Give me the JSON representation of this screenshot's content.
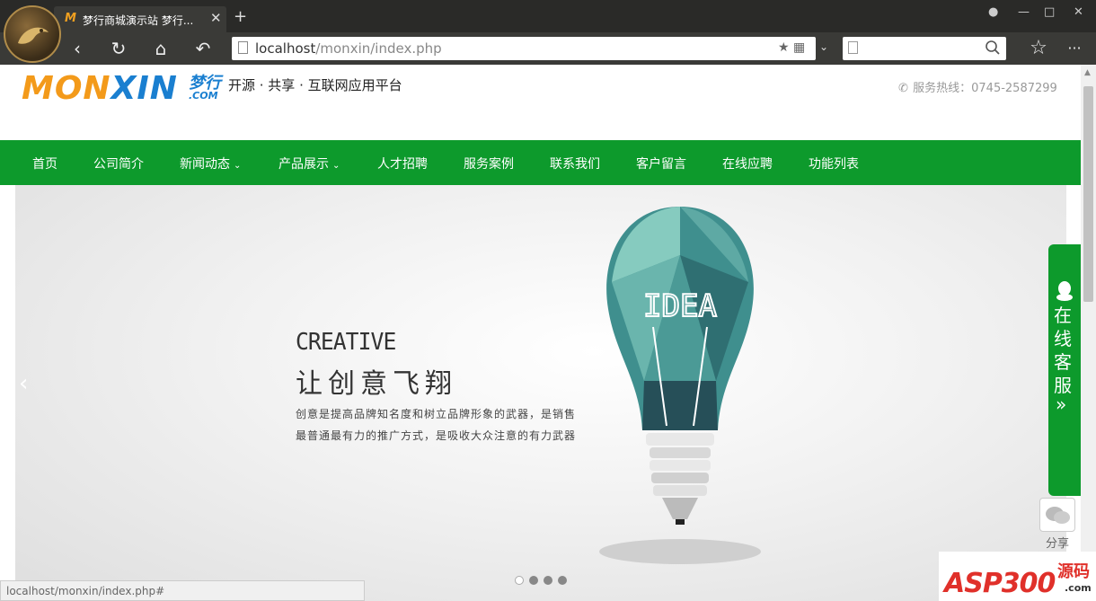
{
  "browser": {
    "tab_title": "梦行商城演示站 梦行...",
    "tab_favicon": "M",
    "url_host": "localhost",
    "url_path": "/monxin/index.php",
    "status_url": "localhost/monxin/index.php#"
  },
  "site": {
    "logo_part1": "MON",
    "logo_part2": "XIN",
    "logo_cn": "梦行",
    "logo_domain": ".COM",
    "slogan": "开源 · 共享 · 互联网应用平台",
    "hotline": "服务热线：0745-2587299"
  },
  "nav": {
    "items": [
      {
        "label": "首页"
      },
      {
        "label": "公司简介"
      },
      {
        "label": "新闻动态"
      },
      {
        "label": "产品展示"
      },
      {
        "label": "人才招聘"
      },
      {
        "label": "服务案例"
      },
      {
        "label": "联系我们"
      },
      {
        "label": "客户留言"
      },
      {
        "label": "在线应聘"
      },
      {
        "label": "功能列表"
      }
    ]
  },
  "banner": {
    "creative": "CREATIVE",
    "headline": "让创意飞翔",
    "desc_line1": "创意是提高品牌知名度和树立品牌形象的武器，是销售",
    "desc_line2": "最普通最有力的推广方式，是吸收大众注意的有力武器",
    "bulb_text": "IDEA",
    "slide_count": 4,
    "active_slide": 1
  },
  "service": {
    "label": "在线客服",
    "share_label": "分享"
  },
  "watermark": {
    "text": "ASP300",
    "cn": "源码",
    "domain": ".com"
  },
  "colors": {
    "nav_green": "#0d9a2c",
    "logo_orange": "#f39a1a",
    "logo_blue": "#1a7fd0",
    "watermark_red": "#e0302a"
  }
}
